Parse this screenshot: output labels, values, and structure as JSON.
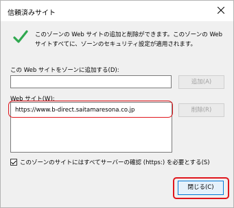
{
  "window": {
    "title": "信頼済みサイト"
  },
  "info_text": "このゾーンの Web サイトの追加と削除ができます。このゾーンの Web サイトすべてに、ゾーンのセキュリティ設定が適用されます。",
  "add": {
    "label": "この Web サイトをゾーンに追加する(D):",
    "value": "",
    "button": "追加(A)"
  },
  "sites": {
    "label": "Web サイト(W):",
    "items": [
      "https://www.b-direct.saitamaresona.co.jp"
    ],
    "remove_button": "削除(R)"
  },
  "https_check": {
    "label": "このゾーンのサイトにはすべてサーバーの確認 (https:) を必要とする(S)",
    "checked": true
  },
  "close_button": "閉じる(C)",
  "colors": {
    "highlight": "#e0151b",
    "check_green": "#2fa84f",
    "accent": "#0078d7"
  }
}
